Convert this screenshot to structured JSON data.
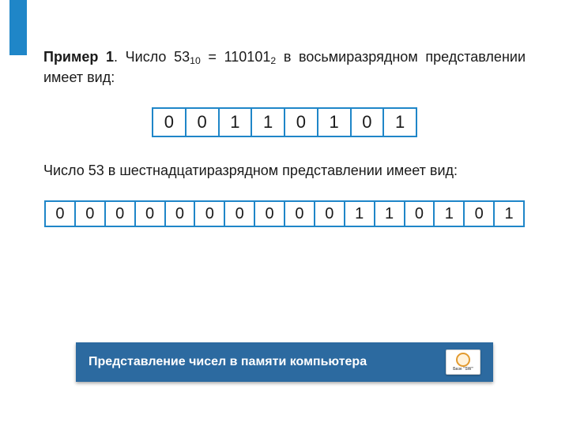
{
  "paragraph1": {
    "label": "Пример 1",
    "sep": ". Число ",
    "dec_value": "53",
    "dec_base": "10",
    "eq": " = ",
    "bin_value": "110101",
    "bin_base": "2",
    "tail": " в восьмиразрядном представлении имеет вид:"
  },
  "bits8": [
    "0",
    "0",
    "1",
    "1",
    "0",
    "1",
    "0",
    "1"
  ],
  "paragraph2": "Число 53 в шестнадцатиразрядном представлении имеет вид:",
  "bits16": [
    "0",
    "0",
    "0",
    "0",
    "0",
    "0",
    "0",
    "0",
    "0",
    "0",
    "1",
    "1",
    "0",
    "1",
    "0",
    "1"
  ],
  "footer": {
    "title": "Представление чисел в памяти компьютера",
    "badge_text": "Базе \"SW\""
  }
}
